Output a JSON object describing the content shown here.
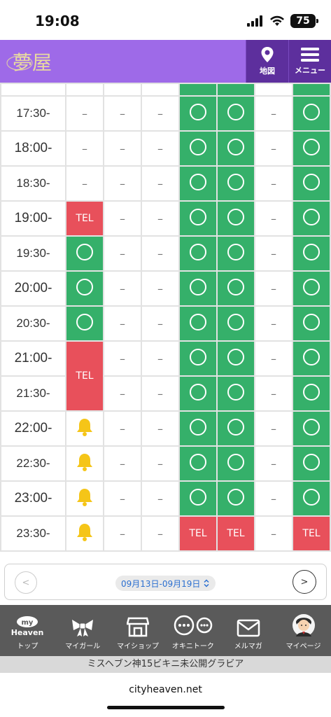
{
  "status_bar": {
    "time": "19:08",
    "battery": "75"
  },
  "header": {
    "logo_text": "夢屋",
    "map_label": "地図",
    "menu_label": "メニュー"
  },
  "schedule": {
    "rows": [
      {
        "time": "17:30-",
        "cells": [
          "–",
          "–",
          "–",
          "○",
          "○",
          "–",
          "○"
        ]
      },
      {
        "time": "18:00-",
        "cells": [
          "–",
          "–",
          "–",
          "○",
          "○",
          "–",
          "○"
        ]
      },
      {
        "time": "18:30-",
        "cells": [
          "–",
          "–",
          "–",
          "○",
          "○",
          "–",
          "○"
        ]
      },
      {
        "time": "19:00-",
        "cells": [
          "TEL",
          "–",
          "–",
          "○",
          "○",
          "–",
          "○"
        ]
      },
      {
        "time": "19:30-",
        "cells": [
          "○",
          "–",
          "–",
          "○",
          "○",
          "–",
          "○"
        ]
      },
      {
        "time": "20:00-",
        "cells": [
          "○",
          "–",
          "–",
          "○",
          "○",
          "–",
          "○"
        ]
      },
      {
        "time": "20:30-",
        "cells": [
          "○",
          "–",
          "–",
          "○",
          "○",
          "–",
          "○"
        ]
      },
      {
        "time": "21:00-",
        "cells": [
          "TEL",
          "–",
          "–",
          "○",
          "○",
          "–",
          "○"
        ]
      },
      {
        "time": "21:30-",
        "cells": [
          "SPAN",
          "–",
          "–",
          "○",
          "○",
          "–",
          "○"
        ]
      },
      {
        "time": "22:00-",
        "cells": [
          "BELL",
          "–",
          "–",
          "○",
          "○",
          "–",
          "○"
        ]
      },
      {
        "time": "22:30-",
        "cells": [
          "BELL",
          "–",
          "–",
          "○",
          "○",
          "–",
          "○"
        ]
      },
      {
        "time": "23:00-",
        "cells": [
          "BELL",
          "–",
          "–",
          "○",
          "○",
          "–",
          "○"
        ]
      },
      {
        "time": "23:30-",
        "cells": [
          "BELL",
          "–",
          "–",
          "TEL",
          "TEL",
          "–",
          "TEL"
        ]
      }
    ]
  },
  "pager": {
    "prev": "<",
    "next": ">",
    "range": "09月13日-09月19日"
  },
  "tabbar": {
    "items": [
      {
        "label": "トップ",
        "icon": "my-heaven-icon",
        "badge_line1": "my",
        "badge_line2": "Heaven"
      },
      {
        "label": "マイガール",
        "icon": "ribbon-icon"
      },
      {
        "label": "マイショップ",
        "icon": "shop-icon"
      },
      {
        "label": "オキニトーク",
        "icon": "chat-bubbles-icon"
      },
      {
        "label": "メルマガ",
        "icon": "mail-icon"
      },
      {
        "label": "マイページ",
        "icon": "avatar-icon"
      }
    ]
  },
  "ticker": {
    "text": "ミスヘブン神15ビキニ未公開グラビア"
  },
  "browser": {
    "url": "cityheaven.net"
  },
  "colors": {
    "header": "#9e6ae8",
    "header_button": "#5d2f9d",
    "available": "#35b06a",
    "tel": "#e8505b",
    "bell": "#f5c518"
  }
}
